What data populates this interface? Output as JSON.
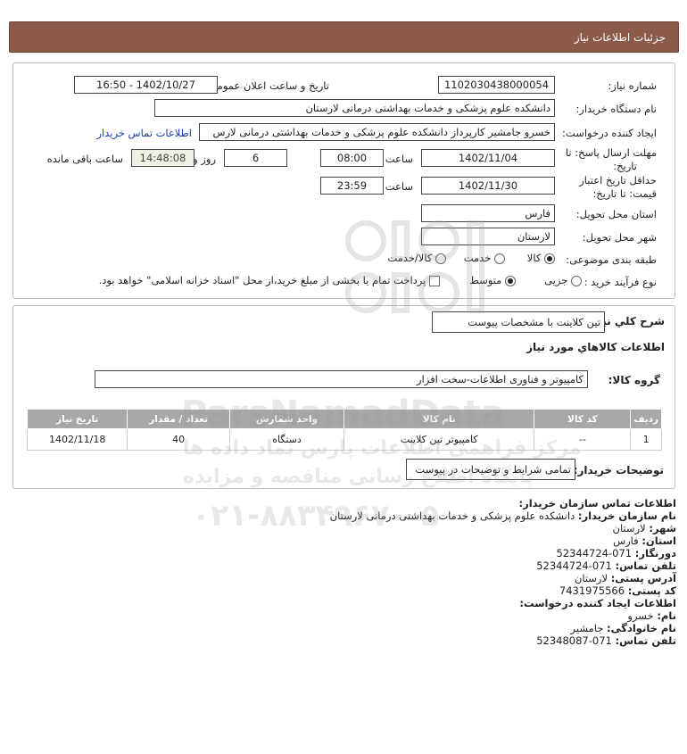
{
  "header": {
    "title": "جزئیات اطلاعات نیاز"
  },
  "form": {
    "need_number_label": "شماره نیاز:",
    "need_number": "1102030438000054",
    "announce_label": "تاریخ و ساعت اعلان عمومی:",
    "announce_value": "1402/10/27 - 16:50",
    "buyer_org_label": "نام دستگاه خریدار:",
    "buyer_org": "دانشکده علوم پزشکی و خدمات بهداشتی  درمانی لارستان",
    "creator_label": "ایجاد کننده درخواست:",
    "creator": "خسرو جامشیر کارپرداز دانشکده علوم پزشکی و خدمات بهداشتی  درمانی لارس",
    "contact_link": "اطلاعات تماس خریدار",
    "deadline_label_1": "مهلت ارسال پاسخ: تا",
    "deadline_label_2": "تاریخ:",
    "deadline_date": "1402/11/04",
    "time_label": "ساعت",
    "deadline_time": "08:00",
    "days_value": "6",
    "days_label": "روز و",
    "remaining_time": "14:48:08",
    "remaining_label": "ساعت باقی مانده",
    "validity_label_1": "حداقل تاریخ اعتبار",
    "validity_label_2": "قیمت: تا تاریخ:",
    "validity_date": "1402/11/30",
    "validity_time": "23:59",
    "province_label": "استان محل تحویل:",
    "province": "فارس",
    "city_label": "شهر محل تحویل:",
    "city": "لارستان",
    "category_label": "طبقه بندی موضوعی:",
    "category_options": [
      "کالا",
      "خدمت",
      "کالا/خدمت"
    ],
    "category_selected": "کالا",
    "process_label": "نوع فرآیند خرید :",
    "process_options": [
      "جزیی",
      "متوسط"
    ],
    "process_selected": "متوسط",
    "payment_note": "پرداخت تمام یا بخشی از مبلغ خرید،از محل \"اسناد خزانه اسلامی\" خواهد بود."
  },
  "details": {
    "summary_label": "شرح كلي نياز:",
    "summary": "تین کلاینت با مشخصات پیوست",
    "goods_info_label": "اطلاعات کالاهاي مورد نياز",
    "group_label": "گروه کالا:",
    "group": "کامپیوتر و فناوری اطلاعات-سخت افزار",
    "table_headers": [
      "ردیف",
      "کد کالا",
      "نام کالا",
      "واحد شمارش",
      "تعداد / مقدار",
      "تاریخ نیاز"
    ],
    "table_rows": [
      [
        "1",
        "--",
        "کامپیوتر تین کلاینت",
        "دستگاه",
        "40",
        "1402/11/18"
      ]
    ],
    "buyer_notes_label": "توضیحات خریدار:",
    "buyer_notes": "تمامی شرایط و توضیحات در پیوست"
  },
  "contact": {
    "heading": "اطلاعات تماس سازمان خریدار:",
    "org_label": "نام سازمان خریدار:",
    "org": "دانشکده علوم پزشکی و خدمات بهداشتی درمانی لارستان",
    "city_label": "شهر:",
    "city": "لارستان",
    "province_label": "استان:",
    "province": "فارس",
    "fax_label": "دورنگار:",
    "fax": "071-52344724",
    "phone_label": "تلفن تماس:",
    "phone": "071-52344724",
    "address_label": "آدرس پستی:",
    "address": "لارستان",
    "postal_label": "کد پستی:",
    "postal": "7431975566",
    "creator_heading": "اطلاعات ایجاد کننده درخواست:",
    "first_name_label": "نام:",
    "first_name": "خسرو",
    "last_name_label": "نام خانوادگی:",
    "last_name": "جامشیر",
    "creator_phone_label": "تلفن تماس:",
    "creator_phone": "071-52348087"
  },
  "watermark": {
    "brand": "ParsNamadData",
    "line1": "مرکز فراهمی اطلاعات پارس نماد داده ها",
    "line2": "پایگاه اطلاع رسانی مناقصه و مزایده",
    "phone": "۰۲۱-۸۸۳۴۹۶۷۰-۵"
  }
}
